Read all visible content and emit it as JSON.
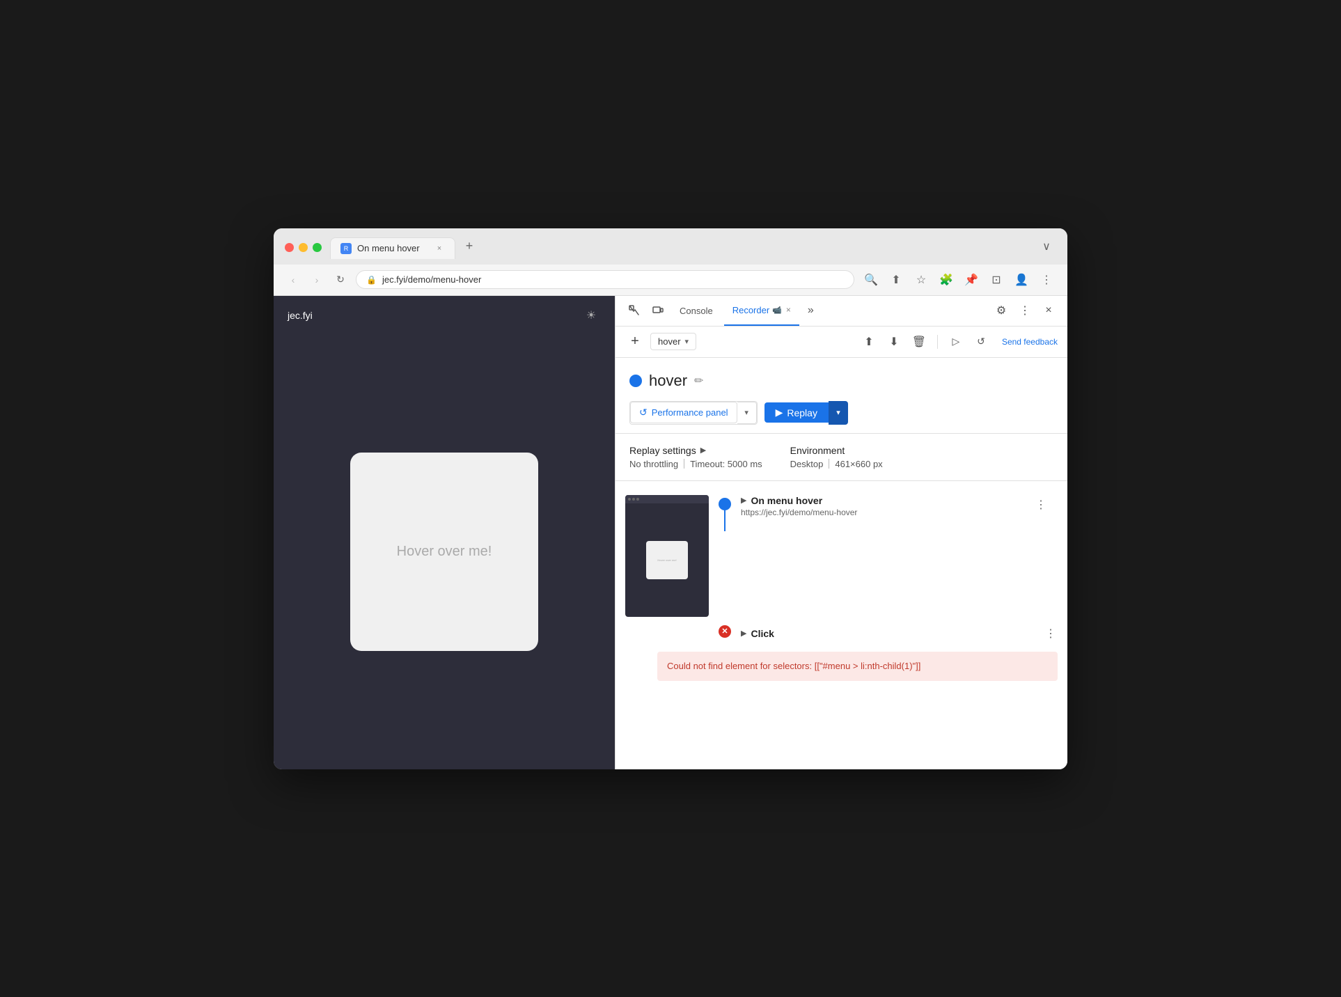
{
  "browser": {
    "traffic_lights": [
      "red",
      "yellow",
      "green"
    ],
    "tab": {
      "favicon_label": "R",
      "title": "On menu hover",
      "close_label": "×"
    },
    "new_tab_label": "+",
    "tab_dropdown_label": "∨",
    "nav": {
      "back_label": "‹",
      "forward_label": "›",
      "refresh_label": "↻"
    },
    "address": {
      "lock_icon": "🔒",
      "url": "jec.fyi/demo/menu-hover"
    },
    "address_actions": {
      "search_label": "🔍",
      "share_label": "⬆",
      "bookmark_label": "☆",
      "extension_label": "🧩",
      "pin_label": "📌",
      "window_label": "⊡",
      "profile_label": "👤",
      "menu_label": "⋮"
    }
  },
  "webpage": {
    "title": "jec.fyi",
    "sun_icon": "☀",
    "hover_card_text": "Hover over me!"
  },
  "devtools": {
    "tabs": [
      {
        "label": "Console",
        "active": false
      },
      {
        "label": "Recorder",
        "active": true
      }
    ],
    "tab_close_label": "×",
    "more_tabs_label": "»",
    "gear_label": "⚙",
    "kebab_label": "⋮",
    "close_label": "×",
    "recording": {
      "add_label": "+",
      "selector_text": "hover",
      "selector_arrow": "▾",
      "upload_label": "⬆",
      "download_label": "⬇",
      "delete_label": "🗑",
      "play_label": "▷",
      "replay_slow_label": "↺",
      "send_feedback_label": "Send feedback",
      "dot_color": "#1a73e8",
      "name": "hover",
      "edit_icon": "✏",
      "perf_panel_icon": "↺",
      "perf_panel_label": "Performance panel",
      "perf_panel_arrow": "▾",
      "replay_icon": "▶",
      "replay_label": "Replay",
      "replay_arrow": "▾"
    },
    "replay_settings": {
      "title": "Replay settings",
      "arrow": "▶",
      "no_throttling": "No throttling",
      "timeout_label": "Timeout: 5000 ms",
      "environment_title": "Environment",
      "desktop_label": "Desktop",
      "dimensions_label": "461×660 px"
    },
    "steps": [
      {
        "id": "step-1",
        "type": "navigate",
        "name": "On menu hover",
        "url": "https://jec.fyi/demo/menu-hover",
        "has_preview": true,
        "connector": "blue",
        "has_line": true
      },
      {
        "id": "step-2",
        "type": "click",
        "name": "Click",
        "connector": "red",
        "has_error": true,
        "error_text": "Could not find element for selectors: [[\"#menu > li:nth-child(1)\"]]"
      }
    ]
  }
}
